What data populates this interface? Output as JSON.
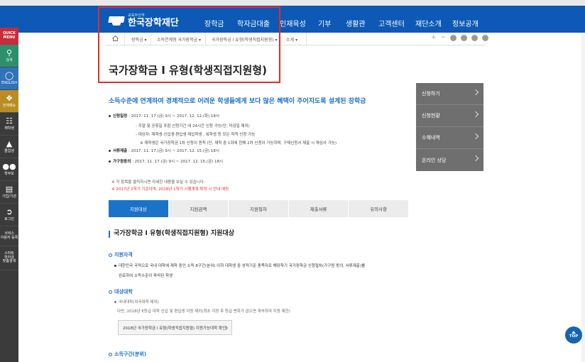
{
  "header": {
    "logo_sub": "교육부산하",
    "logo_main": "한국장학재단",
    "nav": [
      "장학금",
      "학자금대출",
      "인재육성",
      "기부",
      "생활관",
      "고객센터",
      "재단소개",
      "정보공개"
    ]
  },
  "quick_menu": {
    "title": "QUICK\nMENU",
    "items": [
      {
        "label": "검색",
        "icon": "search-icon"
      },
      {
        "label": "ENGLISH",
        "icon": "globe-icon"
      },
      {
        "label": "전체메뉴",
        "icon": "compass-icon"
      },
      {
        "label": "재학생",
        "icon": "book-icon"
      },
      {
        "label": "졸업생",
        "icon": "graduation-cap-icon"
      },
      {
        "label": "학부모",
        "icon": "people-icon"
      },
      {
        "label": "기업/기관",
        "icon": "building-icon"
      },
      {
        "label": "로그인",
        "icon": "login-icon"
      },
      {
        "label": "서비스\n이용자 등록",
        "icon": ""
      },
      {
        "label": "스마트\n학자금\n맞춤검색",
        "icon": ""
      }
    ]
  },
  "breadcrumb": {
    "items": [
      "장학금",
      "소득연계형 국가장학금",
      "국가장학금 I 유형(학생직접지원형)",
      "소개"
    ],
    "tools": [
      "+",
      "−"
    ]
  },
  "page_title": "국가장학금 I 유형(학생직접지원형)",
  "side_menu": [
    "신청하기",
    "신청현황",
    "수혜내역",
    "온라인 상담"
  ],
  "intro": "소득수준에 연계하여 경제적으로 어려운 학생들에게 보다 많은 혜택이 주어지도록 설계된 장학금",
  "schedule": {
    "apply_label": "신청일정",
    "apply_value": ": 2017. 11. 17.(금) 9시 ~ 2017. 12. 12.(화) 18시",
    "apply_notes": [
      "- 주말 및 공휴일 포함 신청기간 내 24시간 신청 가능(단, 마감일 제외)",
      "- 대상자: 재학생·신입생·편입생·재입학생 , 복학생 등 모든 학적 신청 가능",
      "※ 재학생은 국가장학금 1차 신청이 원칙 (단, 재학 중 1회에 한해 2차 신청이 가능하며, 구제신청서 제출 시 재심사 가능)"
    ],
    "doc_label": "서류제출",
    "doc_value": ": 2017. 11. 17.(금) 9시 ~ 2017. 12. 15.(금) 18시",
    "family_label": "가구원동의",
    "family_value": ": 2017. 11. 17.(금) 9시 ~ 2017. 12. 15.(금) 18시"
  },
  "notes": {
    "gray": "※ 각 항목을 클릭하시면 자세한 내용을 보실 수 있습니다.",
    "red": "※ 2017년 2학기 기준이며, 2018년 1학기 시행계획 확정 시 안내 예정"
  },
  "tabs": [
    "지원대상",
    "지원금액",
    "지원절차",
    "제출서류",
    "유의사항"
  ],
  "section": {
    "title": "국가장학금 I 유형(학생직접지원형) 지원대상",
    "eligibility_heading": "지원자격",
    "eligibility_line1": "대한민국 국적으로 국내 대학에 재학 중인 소득 8구간(분위) 이하 대학생 중 성적기준 충족자로 해당학기 국가장학금 신청절차(가구원 동의, 서류제출)를",
    "eligibility_line2": "완료하여 소득수준이 파악된 학생",
    "univ_heading": "대상대학",
    "univ_line1": "국내대학(외국대학 제외)",
    "univ_line2": "다만, 2018년 E등급 대학 신입 및 편입생 지원 제외(최초 지정 후 등급 변화가 없으면 계속하여 지원 제한)",
    "univ_button": "2018년 국가장학금 I 유형(학생직접지원형) 지원가능대학 확인",
    "income_heading": "소득구간(분위)"
  },
  "top_button": "TOP"
}
